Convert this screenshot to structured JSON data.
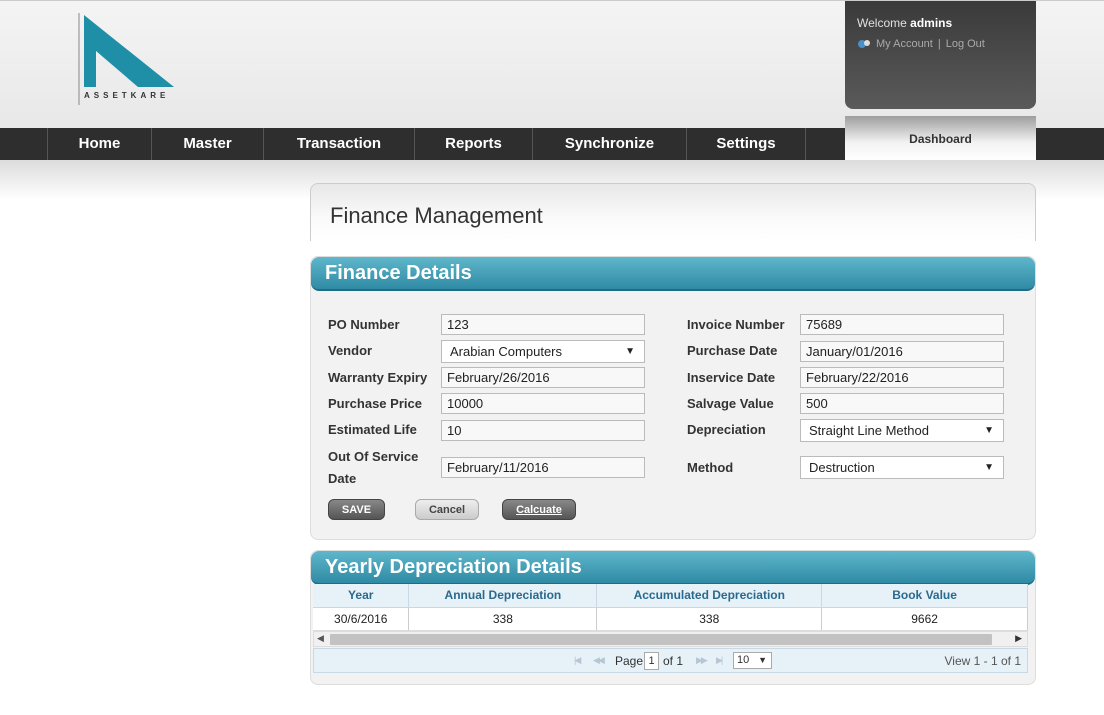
{
  "brand": {
    "name": "ASSETKARE"
  },
  "user": {
    "welcome_prefix": "Welcome",
    "username": "admins",
    "my_account": "My Account",
    "separator": "|",
    "logout": "Log Out"
  },
  "nav": {
    "items": [
      "Home",
      "Master",
      "Transaction",
      "Reports",
      "Synchronize",
      "Settings"
    ],
    "dashboard": "Dashboard"
  },
  "page": {
    "title": "Finance Management"
  },
  "finance": {
    "heading": "Finance Details",
    "po_number_label": "PO Number",
    "po_number": "123",
    "vendor_label": "Vendor",
    "vendor": "Arabian Computers",
    "warranty_label": "Warranty Expiry",
    "warranty": "February/26/2016",
    "purchase_price_label": "Purchase Price",
    "purchase_price": "10000",
    "estimated_life_label": "Estimated Life",
    "estimated_life": "10",
    "out_of_service_label_1": "Out Of Service",
    "out_of_service_label_2": "Date",
    "out_of_service": "February/11/2016",
    "invoice_label": "Invoice Number",
    "invoice": "75689",
    "purchase_date_label": "Purchase Date",
    "purchase_date": "January/01/2016",
    "inservice_label": "Inservice Date",
    "inservice": "February/22/2016",
    "salvage_label": "Salvage Value",
    "salvage": "500",
    "depreciation_label": "Depreciation",
    "depreciation": "Straight Line Method",
    "method_label": "Method",
    "method": "Destruction",
    "save": "SAVE",
    "cancel": "Cancel",
    "calculate": "Calcuate"
  },
  "yearly": {
    "heading": "Yearly Depreciation Details",
    "columns": [
      "Year",
      "Annual Depreciation",
      "Accumulated Depreciation",
      "Book Value"
    ],
    "rows": [
      [
        "30/6/2016",
        "338",
        "338",
        "9662"
      ]
    ],
    "pager": {
      "page_label": "Page",
      "page": "1",
      "of_label": "of 1",
      "page_size": "10",
      "view": "View 1 - 1 of 1"
    }
  },
  "colors": {
    "accent": "#3a94ad",
    "nav_bg": "#2e2e2e"
  }
}
